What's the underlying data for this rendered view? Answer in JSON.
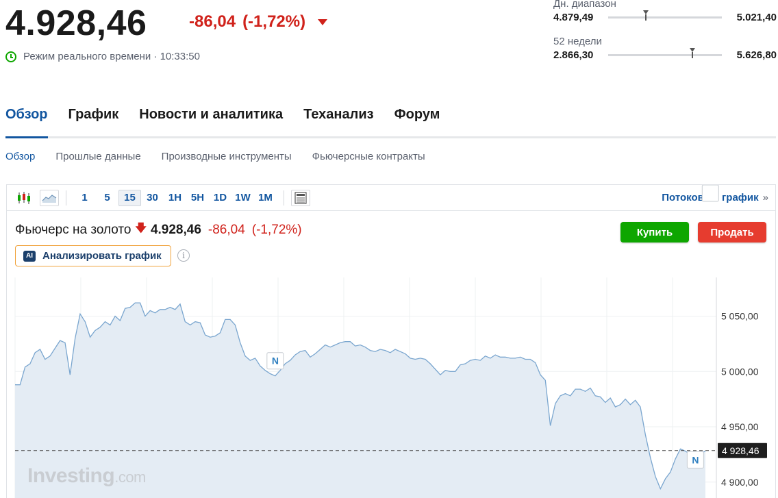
{
  "quote": {
    "last": "4.928,46",
    "change": "-86,04",
    "change_pct": "(-1,72%)",
    "realtime_text": "Режим реального времени · 10:33:50"
  },
  "day_range": {
    "label": "Дн. диапазон",
    "low": "4.879,49",
    "high": "5.021,40",
    "position": 0.33
  },
  "week52_range": {
    "label": "52 недели",
    "low": "2.866,30",
    "high": "5.626,80",
    "position": 0.74
  },
  "main_tabs": [
    {
      "label": "Обзор",
      "active": true
    },
    {
      "label": "График",
      "active": false
    },
    {
      "label": "Новости и аналитика",
      "active": false
    },
    {
      "label": "Теханализ",
      "active": false
    },
    {
      "label": "Форум",
      "active": false
    }
  ],
  "sub_tabs": [
    {
      "label": "Обзор",
      "active": true
    },
    {
      "label": "Прошлые данные",
      "active": false
    },
    {
      "label": "Производные инструменты",
      "active": false
    },
    {
      "label": "Фьючерсные контракты",
      "active": false
    }
  ],
  "toolbar": {
    "timeframes": [
      "1",
      "5",
      "15",
      "30",
      "1H",
      "5H",
      "1D",
      "1W",
      "1M"
    ],
    "active_timeframe": "15",
    "stream_label": "Потоковый график",
    "stream_arrow": "»"
  },
  "instrument": {
    "name": "Фьючерс на золото",
    "last": "4.928,46",
    "change": "-86,04",
    "change_pct": "(-1,72%)"
  },
  "buttons": {
    "buy": "Купить",
    "sell": "Продать",
    "analyze": "Анализировать график",
    "ai_badge": "AI",
    "info": "i"
  },
  "watermark": {
    "brand": "Investing",
    "suffix": ".com"
  },
  "colors": {
    "accent": "#1256a0",
    "down": "#d0221b",
    "buy": "#0ea600",
    "sell": "#e63c2f",
    "line": "#7aa6cf",
    "area": "#e4ecf4"
  },
  "chart_data": {
    "type": "area",
    "y_ticks": [
      "5 050,00",
      "5 000,00",
      "4 950,00",
      "4 900,00"
    ],
    "y_tick_values": [
      5050,
      5000,
      4950,
      4900
    ],
    "ylim": [
      4885,
      5085
    ],
    "last_label": "4 928,46",
    "last_value": 4928.46,
    "news_label": "N",
    "news_markers": [
      {
        "index": 52
      },
      {
        "index": 136
      },
      {
        "index": 139
      }
    ],
    "values": [
      4988,
      4988,
      5004,
      5007,
      5017,
      5020,
      5011,
      5014,
      5021,
      5028,
      5026,
      4997,
      5030,
      5052,
      5045,
      5031,
      5037,
      5040,
      5045,
      5042,
      5050,
      5046,
      5057,
      5058,
      5062,
      5062,
      5050,
      5055,
      5053,
      5056,
      5056,
      5058,
      5056,
      5061,
      5045,
      5042,
      5045,
      5044,
      5033,
      5031,
      5032,
      5035,
      5047,
      5047,
      5042,
      5026,
      5014,
      5010,
      5012,
      5005,
      5001,
      4998,
      4996,
      5001,
      5007,
      5010,
      5015,
      5018,
      5019,
      5013,
      5016,
      5020,
      5024,
      5022,
      5024,
      5026,
      5027,
      5027,
      5023,
      5024,
      5022,
      5019,
      5018,
      5020,
      5019,
      5017,
      5020,
      5018,
      5016,
      5012,
      5011,
      5012,
      5011,
      5007,
      5002,
      4997,
      5001,
      5000,
      5000,
      5006,
      5007,
      5010,
      5011,
      5010,
      5014,
      5012,
      5015,
      5013,
      5013,
      5012,
      5012,
      5013,
      5011,
      5011,
      5008,
      4997,
      4992,
      4951,
      4971,
      4978,
      4980,
      4978,
      4984,
      4984,
      4982,
      4985,
      4978,
      4977,
      4972,
      4976,
      4968,
      4970,
      4975,
      4970,
      4974,
      4968,
      4943,
      4922,
      4905,
      4894,
      4903,
      4909,
      4921,
      4930,
      4928,
      4925,
      4925,
      4926,
      4928
    ]
  }
}
